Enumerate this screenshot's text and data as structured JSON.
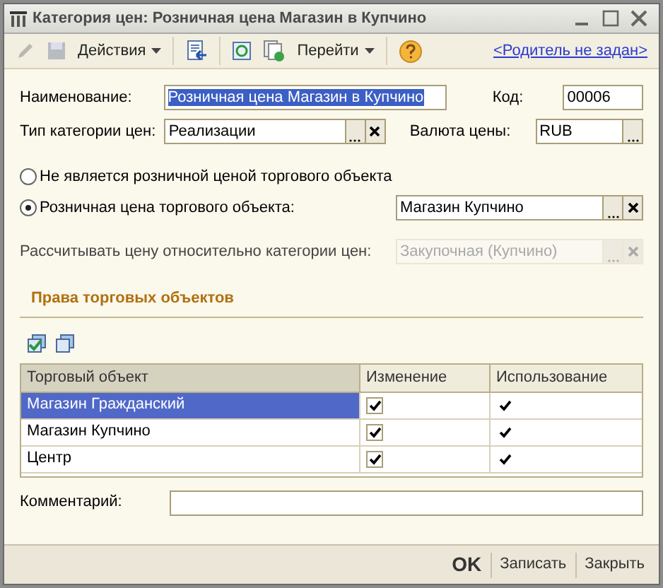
{
  "window": {
    "title": "Категория цен: Розничная цена Магазин в Купчино"
  },
  "toolbar": {
    "actions": "Действия",
    "goto": "Перейти",
    "parent_link": "<Родитель не задан>"
  },
  "name_field": {
    "label": "Наименование:",
    "value": "Розничная цена Магазин в Купчино",
    "selected": true
  },
  "code_field": {
    "label": "Код:",
    "value": "00006"
  },
  "price_type_field": {
    "label": "Тип категории цен:",
    "value": "Реализации"
  },
  "currency_field": {
    "label": "Валюта цены:",
    "value": "RUB"
  },
  "radios": [
    {
      "label": "Не является розничной ценой торгового объекта",
      "selected": false
    },
    {
      "label": "Розничная цена торгового объекта:",
      "selected": true
    }
  ],
  "retail_object_field": {
    "value": "Магазин Купчино"
  },
  "relative_field": {
    "label": "Рассчитывать цену относительно категории цен:",
    "value": "Закупочная (Купчино)",
    "disabled": true
  },
  "section_title": "Права торговых объектов",
  "table": {
    "columns": [
      "Торговый объект",
      "Изменение",
      "Использование"
    ],
    "rows": [
      {
        "object": "Магазин Гражданский",
        "change": true,
        "use": true,
        "selected": true
      },
      {
        "object": "Магазин Купчино",
        "change": true,
        "use": true,
        "selected": false
      },
      {
        "object": "Центр",
        "change": true,
        "use": true,
        "selected": false
      }
    ]
  },
  "comment_field": {
    "label": "Комментарий:"
  },
  "buttons": [
    {
      "label": "OK",
      "kind": "default"
    },
    {
      "label": "Записать",
      "kind": "normal"
    },
    {
      "label": "Закрыть",
      "kind": "normal"
    }
  ]
}
